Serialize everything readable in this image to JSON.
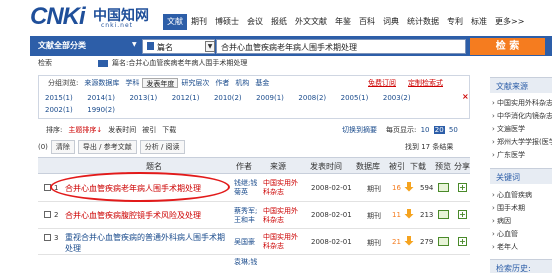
{
  "header": {
    "logo_latin": "CNKi",
    "logo_cn": "中国知网",
    "logo_url": "cnki.net",
    "nav": [
      "文献",
      "期刊",
      "博硕士",
      "会议",
      "报纸",
      "外文文献",
      "年鉴",
      "百科",
      "词典",
      "统计数据",
      "专利",
      "标准",
      "更多>>"
    ]
  },
  "search": {
    "scope": "文献全部分类",
    "field": "篇名",
    "query": "合并心血管疾病老年病人围手术期处理",
    "button": "检 索"
  },
  "retrieval": {
    "label": "检索",
    "text": "篇名:合并心血管疾病老年病人围手术期处理"
  },
  "grouping": {
    "label": "分组浏览:",
    "tabs": [
      "来源数据库",
      "学科",
      "发表年度",
      "研究层次",
      "作者",
      "机构",
      "基金"
    ],
    "active_tab": "发表年度",
    "free_sub": "免费订阅",
    "custom_sub": "定制检索式",
    "years": [
      "2015(1)",
      "2014(1)",
      "2013(1)",
      "2012(1)",
      "2010(2)",
      "2009(1)",
      "2008(2)",
      "2005(1)",
      "2003(2)",
      "2002(1)",
      "1990(2)"
    ],
    "close": "×"
  },
  "sort": {
    "label": "排序:",
    "options": [
      "主题排序↓",
      "发表时间",
      "被引",
      "下载"
    ],
    "switch_brief": "切换到摘要",
    "per_page_label": "每页显示:",
    "per_page": [
      "10",
      "20",
      "50"
    ],
    "per_page_selected": "20"
  },
  "actions": {
    "selected": "(0)",
    "clear": "清除",
    "export": "导出 / 参考文献",
    "analyze": "分析 / 阅读",
    "found": "找到 17 条结果"
  },
  "table": {
    "headers": [
      "题名",
      "作者",
      "来源",
      "发表时间",
      "数据库",
      "被引",
      "下载",
      "预览",
      "分享"
    ],
    "rows": [
      {
        "no": "1",
        "title": "合并心血管疾病老年病人围手术期处理",
        "author": "钱继;钱菊英",
        "source": "中国实用外科杂志",
        "date": "2008-02-01",
        "db": "期刊",
        "cite": "16",
        "download": "594"
      },
      {
        "no": "2",
        "title": "合并心血管疾病腹腔镜手术风险及处理",
        "author": "蔡秀军;王和丰",
        "source": "中国实用外科杂志",
        "date": "2008-02-01",
        "db": "期刊",
        "cite": "11",
        "download": "213"
      },
      {
        "no": "3",
        "title": "重视合并心血管疾病的普通外科病人围手术期处理",
        "author": "吴国豪",
        "source": "中国实用外科杂志",
        "date": "2008-02-01",
        "db": "期刊",
        "cite": "21",
        "download": "279"
      },
      {
        "no": "4",
        "title": "",
        "author": "袁琳;钱",
        "source": "",
        "date": "",
        "db": "",
        "cite": "",
        "download": ""
      }
    ]
  },
  "sidebar": {
    "source_head": "文献来源",
    "sources": [
      "中国实用外科杂志",
      "中华消化内镜杂志",
      "文遍医学",
      "郑州大学学报(医学",
      "广东医学"
    ],
    "keyword_head": "关键词",
    "keywords": [
      "心血管疾病",
      "围手术期",
      "病因",
      "心血管",
      "老年人"
    ],
    "history_head": "检索历史:"
  },
  "colors": {
    "brand": "#2d5ea8",
    "accent": "#f57c1f",
    "red": "#c00"
  }
}
